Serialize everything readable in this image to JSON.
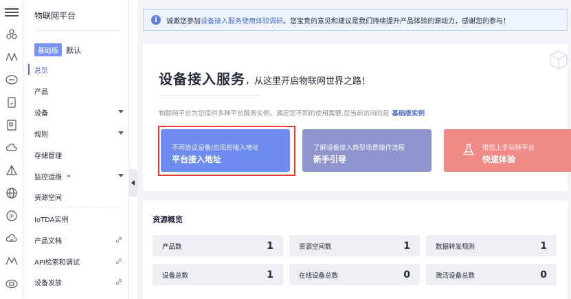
{
  "sidebar": {
    "title": "物联网平台",
    "edition_badge": "基础版",
    "edition_name": "默认",
    "items": [
      {
        "label": "总览"
      },
      {
        "label": "产品"
      },
      {
        "label": "设备"
      },
      {
        "label": "规则"
      },
      {
        "label": "存储管理"
      },
      {
        "label": "监控运维"
      },
      {
        "label": "资源空间"
      },
      {
        "label": "IoTDA实例"
      },
      {
        "label": "产品文档"
      },
      {
        "label": "API检索和调试"
      },
      {
        "label": "设备发放"
      }
    ]
  },
  "notice": {
    "prefix": "诚邀您参加",
    "link": "设备接入服务使用体验调研",
    "suffix": "。您宝贵的意见和建议是我们持续提升产品体验的源动力，感谢您的参与！"
  },
  "hero": {
    "title": "设备接入服务",
    "subtitle": "，从这里开启物联网世界之路！",
    "desc": "物联网平台为您提供多种平台服务实例，满足您不同的使用需要,您当前访问的是",
    "instance": "基础版实例",
    "cards": [
      {
        "sub": "不同协议设备/应用的接入地址",
        "title": "平台接入地址"
      },
      {
        "sub": "了解设备接入典型场景操作流程",
        "title": "新手引导"
      },
      {
        "sub": "带您上手玩转平台",
        "title": "快速体验"
      }
    ]
  },
  "overview": {
    "title": "资源概览",
    "stats": [
      {
        "label": "产品数",
        "value": "1"
      },
      {
        "label": "资源空间数",
        "value": "1"
      },
      {
        "label": "数据转发规则",
        "value": "1"
      },
      {
        "label": "设备总数",
        "value": "1"
      },
      {
        "label": "在线设备总数",
        "value": "0"
      },
      {
        "label": "激活设备总数",
        "value": "0"
      }
    ]
  },
  "colors": {
    "accent": "#526ecc",
    "card1": "#6e8cf0",
    "card2": "#8e95cc",
    "card3": "#f08a86",
    "highlight": "#e53935"
  }
}
